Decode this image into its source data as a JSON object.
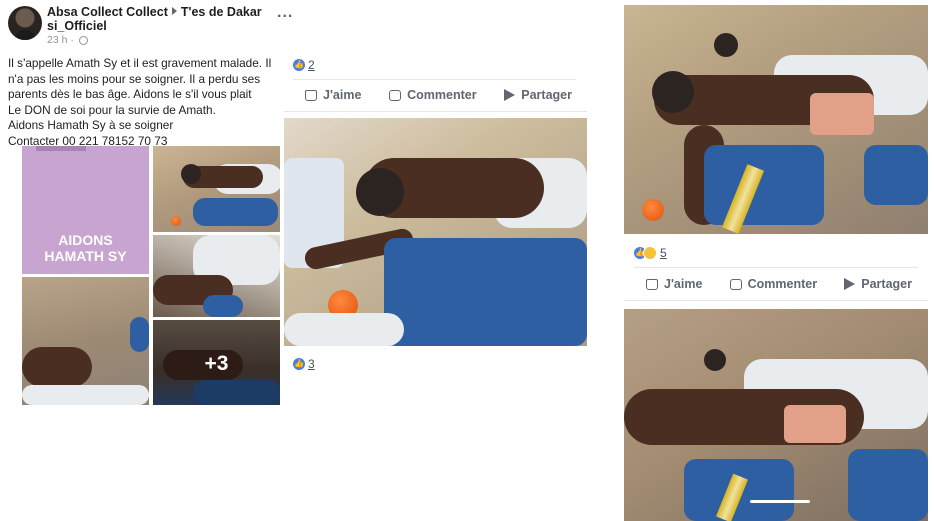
{
  "post": {
    "author": "Absa Collect Collect",
    "group": "T'es de Dakar",
    "group_line2": "si_Officiel",
    "time": "23 h",
    "more": "...",
    "text_lines": [
      "Il s'appelle Amath Sy et il est gravement malade. Il",
      "n'a pas les moins pour se soigner. Il a perdu ses",
      "parents dès le bas âge. Aidons le s'il vous plait",
      "Le DON de soi pour la survie de Amath.",
      "Aidons Hamath Sy à se soigner",
      "Contacter 00 221 78152 70 73"
    ],
    "grid": {
      "poster_line1": "AIDONS",
      "poster_line2": "HAMATH SY",
      "more_count": "+3"
    }
  },
  "panel2": {
    "reactions_top": "2",
    "actions": {
      "like": "J'aime",
      "comment": "Commenter",
      "share": "Partager"
    },
    "reactions_bottom": "3"
  },
  "panel3": {
    "reactions": "5",
    "actions": {
      "like": "J'aime",
      "comment": "Commenter",
      "share": "Partager"
    }
  },
  "colors": {
    "link_blue": "#4a7ce8",
    "poster_purple": "#c8a5d0",
    "text": "#1c1e21",
    "muted": "#606770"
  }
}
